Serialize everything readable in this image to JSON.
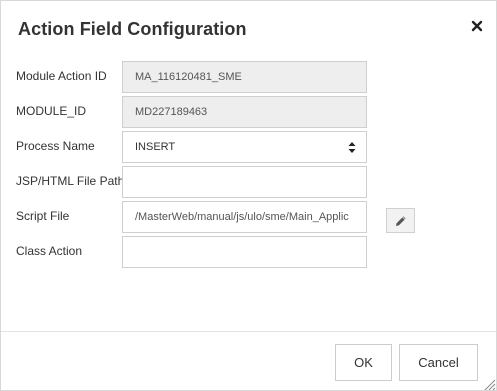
{
  "dialog": {
    "title": "Action Field Configuration",
    "close_icon": "close-icon"
  },
  "fields": {
    "module_action_id": {
      "label": "Module Action ID",
      "value": "MA_116120481_SME"
    },
    "module_id": {
      "label": "MODULE_ID",
      "value": "MD227189463"
    },
    "process_name": {
      "label": "Process Name",
      "value": "INSERT"
    },
    "jsp_html_file_path": {
      "label": "JSP/HTML File Path",
      "value": ""
    },
    "script_file": {
      "label": "Script File",
      "value": "/MasterWeb/manual/js/ulo/sme/Main_Applic"
    },
    "class_action": {
      "label": "Class Action",
      "value": ""
    }
  },
  "footer": {
    "ok_label": "OK",
    "cancel_label": "Cancel"
  },
  "icons": {
    "close": "close-icon",
    "select_arrows": "select-arrows-icon",
    "edit": "pencil-icon",
    "resize": "resize-grip-icon"
  },
  "colors": {
    "readonly_bg": "#eeeeee",
    "border": "#cfcfcf",
    "text": "#333333"
  }
}
